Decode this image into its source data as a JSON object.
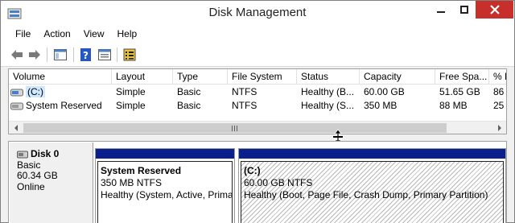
{
  "window": {
    "title": "Disk Management"
  },
  "menu": {
    "items": [
      "File",
      "Action",
      "View",
      "Help"
    ]
  },
  "table": {
    "columns": [
      "Volume",
      "Layout",
      "Type",
      "File System",
      "Status",
      "Capacity",
      "Free Spa...",
      "% F"
    ],
    "rows": [
      [
        "(C:)",
        "Simple",
        "Basic",
        "NTFS",
        "Healthy (B...",
        "60.00 GB",
        "51.65 GB",
        "86"
      ],
      [
        "System Reserved",
        "Simple",
        "Basic",
        "NTFS",
        "Healthy (S...",
        "350 MB",
        "88 MB",
        "25"
      ]
    ]
  },
  "disk": {
    "name": "Disk 0",
    "type": "Basic",
    "size": "60.34 GB",
    "state": "Online",
    "partitions": [
      {
        "name": "System Reserved",
        "size_fs": "350 MB NTFS",
        "status": "Healthy (System, Active, Prima"
      },
      {
        "name": "(C:)",
        "size_fs": "60.00 GB NTFS",
        "status": "Healthy (Boot, Page File, Crash Dump, Primary Partition)"
      }
    ]
  },
  "colors": {
    "partition_bar": "#0a1f8c",
    "close_button": "#c7302a",
    "selection": "#cde8ff"
  }
}
